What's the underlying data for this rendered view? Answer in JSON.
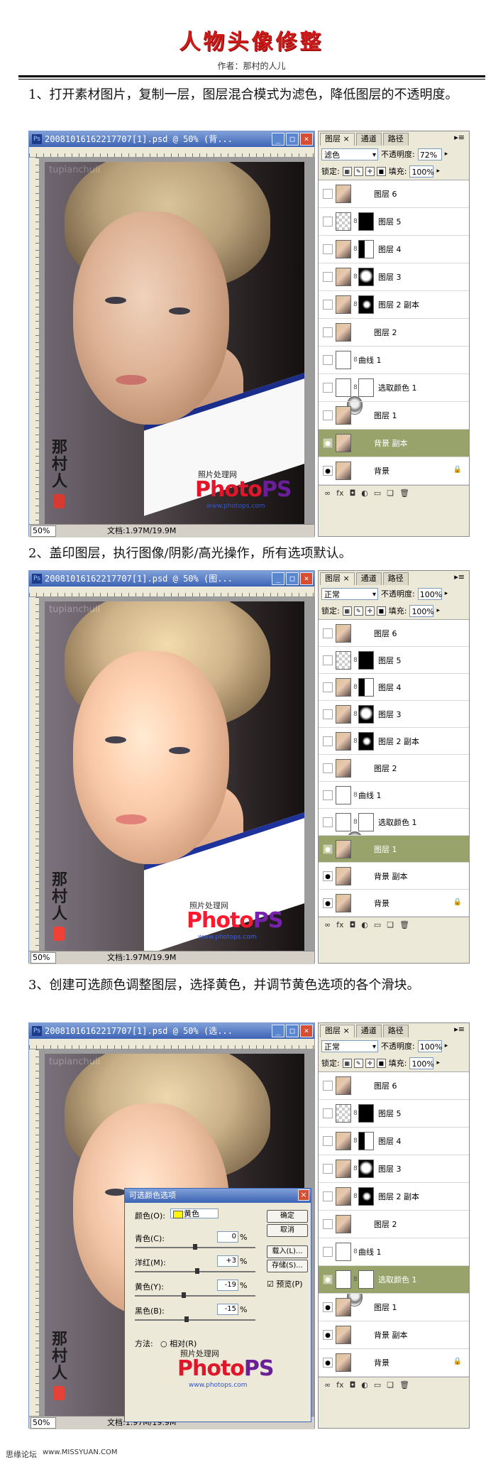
{
  "header": {
    "title": "人物头像修整",
    "author": "作者：那村的人儿"
  },
  "steps": [
    "1、打开素材图片，复制一层，图层混合模式为滤色，降低图层的不透明度。",
    "2、盖印图层，执行图像/阴影/高光操作，所有选项默认。",
    "3、创建可选颜色调整图层，选择黄色，并调节黄色选项的各个滑块。"
  ],
  "window": {
    "titles": [
      "20081016162217707[1].psd @ 50% (背...",
      "20081016162217707[1].psd @ 50% (图...",
      "20081016162217707[1].psd @ 50% (选..."
    ],
    "zoom": "50%",
    "doc_size": "文档:1.97M/19.9M",
    "watermark": "tupianchuli",
    "seal_text": "那村的人儿"
  },
  "brand": {
    "small": "照片处理网",
    "big_a": "Photo",
    "big_b": "PS",
    "url": "www.photops.com"
  },
  "panel": {
    "tabs": [
      "图层 ×",
      "通道",
      "路径"
    ],
    "blend_modes": [
      "滤色",
      "正常",
      "正常"
    ],
    "opacity_label": "不透明度:",
    "opacity_values": [
      "72%",
      "100%",
      "100%"
    ],
    "lock_label": "锁定:",
    "fill_label": "填充:",
    "fill_value": "100%",
    "layers": [
      "图层 6",
      "图层 5",
      "图层 4",
      "图层 3",
      "图层 2 副本",
      "图层 2",
      "曲线 1",
      "选取颜色 1",
      "图层 1",
      "背景 副本",
      "背景"
    ],
    "selected": [
      "背景 副本",
      "图层 1",
      "选取颜色 1"
    ]
  },
  "dialog": {
    "title": "可选颜色选项",
    "color_label": "颜色(O):",
    "color_value": "黄色",
    "rows": [
      {
        "label": "青色(C):",
        "value": "0"
      },
      {
        "label": "洋红(M):",
        "value": "+3"
      },
      {
        "label": "黄色(Y):",
        "value": "-19"
      },
      {
        "label": "黑色(B):",
        "value": "-15"
      }
    ],
    "pct": "%",
    "buttons": [
      "确定",
      "取消",
      "载入(L)...",
      "存储(S)..."
    ],
    "preview": "预览(P)",
    "method": "方法:",
    "method_rel": "相对(R)"
  },
  "footer": {
    "left": "思缘论坛",
    "right": "www.MISSYUAN.COM"
  }
}
